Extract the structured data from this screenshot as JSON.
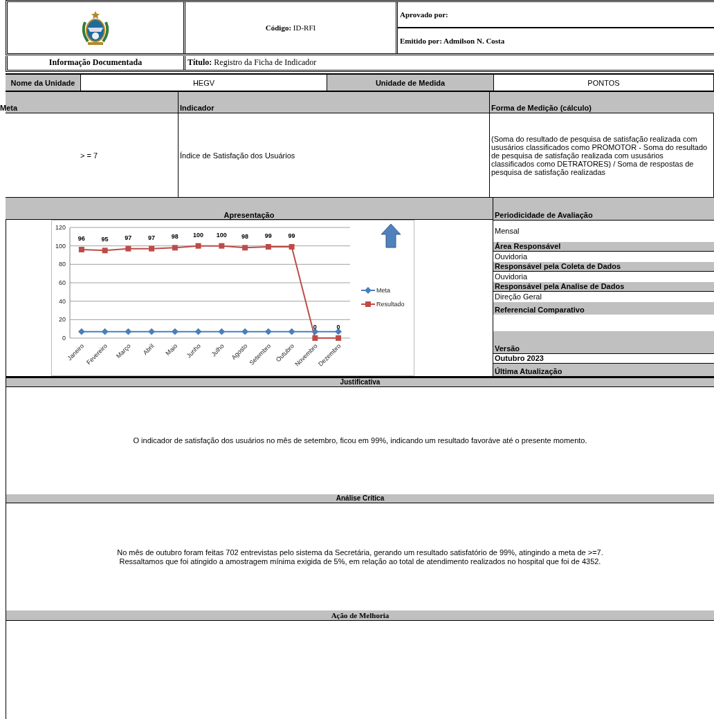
{
  "header": {
    "code_label": "Código:",
    "code": "ID-RFI",
    "approved_label": "Aprovado por:",
    "issued_label": "Emitido por: Admilson N. Costa",
    "doc_info": "Informação Documentada",
    "title_label": "Título:",
    "title": "Registro da Ficha de Indicador"
  },
  "unit": {
    "name_label": "Nome da Unidade",
    "name": "HEGV",
    "measure_label": "Unidade de Medida",
    "measure": "PONTOS"
  },
  "columns": [
    "Meta",
    "Indicador",
    "Forma de Medição (cálculo)"
  ],
  "values": [
    "> = 7",
    "Índice de Satisfação dos Usuários",
    "(Soma do resultado de pesquisa de satisfação realizada com ususários classificados como PROMOTOR - Soma do resultado de pesquisa de satisfação realizada com ususários classificados como DETRATORES) / Soma de respostas de pesquisa de satisfação realizadas"
  ],
  "presentation": {
    "title": "Apresentação",
    "chart_data": {
      "type": "line",
      "categories": [
        "Janeiro",
        "Fevereiro",
        "Março",
        "Abril",
        "Maio",
        "Junho",
        "Julho",
        "Agosto",
        "Setembro",
        "Outubro",
        "Novembro",
        "Dezembro"
      ],
      "series": [
        {
          "name": "Meta",
          "color": "#4a7ebb",
          "marker": "diamond",
          "values": [
            7,
            7,
            7,
            7,
            7,
            7,
            7,
            7,
            7,
            7,
            7,
            7
          ]
        },
        {
          "name": "Resultado",
          "color": "#be4b48",
          "marker": "square",
          "values": [
            96,
            95,
            97,
            97,
            98,
            100,
            100,
            98,
            99,
            99,
            0,
            0
          ]
        }
      ],
      "grid": true,
      "legend": true,
      "ylim": [
        0,
        120
      ],
      "yticks": [
        0,
        20,
        40,
        60,
        80,
        100,
        120
      ],
      "value_labels": [
        "96",
        "95",
        "97",
        "97",
        "98",
        "100",
        "100",
        "98",
        "99",
        "99",
        "0",
        "0"
      ]
    }
  },
  "evaluation": [
    {
      "kind": "label",
      "text": "Periodicidade de Avaliação"
    },
    {
      "kind": "value",
      "text": "Mensal"
    },
    {
      "kind": "label",
      "text": "Área Responsável"
    },
    {
      "kind": "value",
      "text": "Ouvidoria"
    },
    {
      "kind": "label",
      "text": "Responsável pela Coleta de Dados"
    },
    {
      "kind": "value",
      "text": "Ouvidoria"
    },
    {
      "kind": "label",
      "text": "Responsável pela Analise de Dados"
    },
    {
      "kind": "value",
      "text": "Direção Geral"
    },
    {
      "kind": "label",
      "text": "Referencial Comparativo"
    }
  ],
  "version": [
    {
      "kind": "label",
      "text": "Versão"
    },
    {
      "kind": "strong",
      "text": "Outubro 2023"
    },
    {
      "kind": "label",
      "text": "Última Atualização"
    }
  ],
  "sections": [
    {
      "kind": "sans",
      "title": "Justificativa",
      "lines": [
        "O indicador de satisfação dos usuários no mês de setembro, ficou em 99%, indicando um resultado favoráve até o presente momento."
      ]
    },
    {
      "kind": "sans",
      "title": "Análise Crítica",
      "lines": [
        "No mês de outubro foram feitas 702 entrevistas pelo sistema da Secretária, gerando um resultado satisfatório de 99%, atingindo a meta de >=7.",
        "Ressaltamos que foi atingido a amostragem mínima exigida de 5%, em relação ao total de atendimento realizados no hospital que foi de 4352."
      ]
    },
    {
      "kind": "serif",
      "title": "Ação de Melhoria"
    }
  ]
}
